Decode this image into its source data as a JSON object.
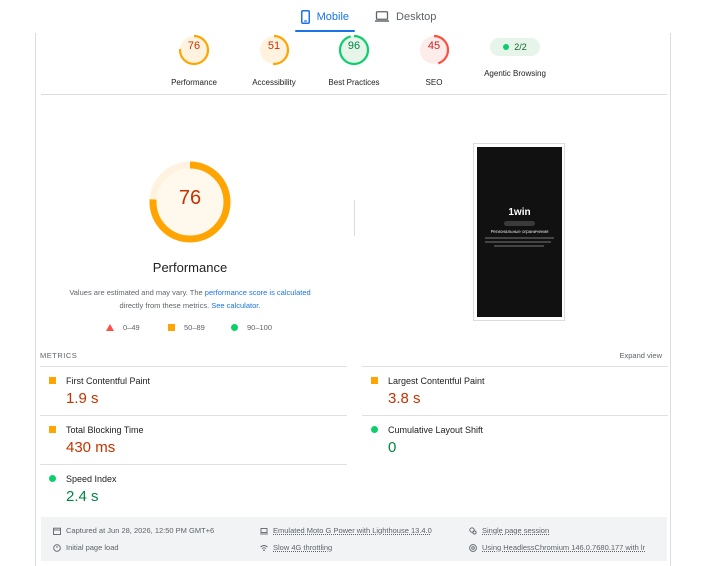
{
  "tabs": {
    "mobile": "Mobile",
    "desktop": "Desktop"
  },
  "summary_gauges": [
    {
      "score": "76",
      "label": "Performance",
      "color": "#ffa400",
      "fill": 0.76
    },
    {
      "score": "51",
      "label": "Accessibility",
      "color": "#ffa400",
      "fill": 0.51
    },
    {
      "score": "96",
      "label": "Best Practices",
      "color": "#0cce6b",
      "fill": 0.96
    },
    {
      "score": "45",
      "label": "SEO",
      "color": "#ff4e42",
      "fill": 0.45
    }
  ],
  "agentic": {
    "value": "2/2",
    "label": "Agentic Browsing"
  },
  "performance": {
    "score": "76",
    "fill": 0.76,
    "title": "Performance",
    "note_prefix": "Values are estimated and may vary. The ",
    "note_link1": "performance score is calculated",
    "note_middle": " directly from these metrics. ",
    "note_link2": "See calculator.",
    "legend": [
      "0–49",
      "50–89",
      "90–100"
    ]
  },
  "screenshot": {
    "logo": "1win",
    "heading": "Региональные ограничения"
  },
  "metrics": {
    "label": "METRICS",
    "expand": "Expand view",
    "items": [
      {
        "name": "First Contentful Paint",
        "value": "1.9 s",
        "status": "average"
      },
      {
        "name": "Largest Contentful Paint",
        "value": "3.8 s",
        "status": "average"
      },
      {
        "name": "Total Blocking Time",
        "value": "430 ms",
        "status": "average"
      },
      {
        "name": "Cumulative Layout Shift",
        "value": "0",
        "status": "pass"
      },
      {
        "name": "Speed Index",
        "value": "2.4 s",
        "status": "pass"
      }
    ]
  },
  "footer": {
    "captured": "Captured at Jun 28, 2026, 12:50 PM GMT+6",
    "initial": "Initial page load",
    "device": "Emulated Moto G Power with Lighthouse 13.4.0",
    "throttle": "Slow 4G throttling",
    "session": "Single page session",
    "browser": "Using HeadlessChromium 146.0.7680.177 with lr"
  },
  "colors": {
    "fail": "#ff4e42",
    "average": "#ffa400",
    "pass": "#0cce6b",
    "link": "#1a73e8"
  }
}
